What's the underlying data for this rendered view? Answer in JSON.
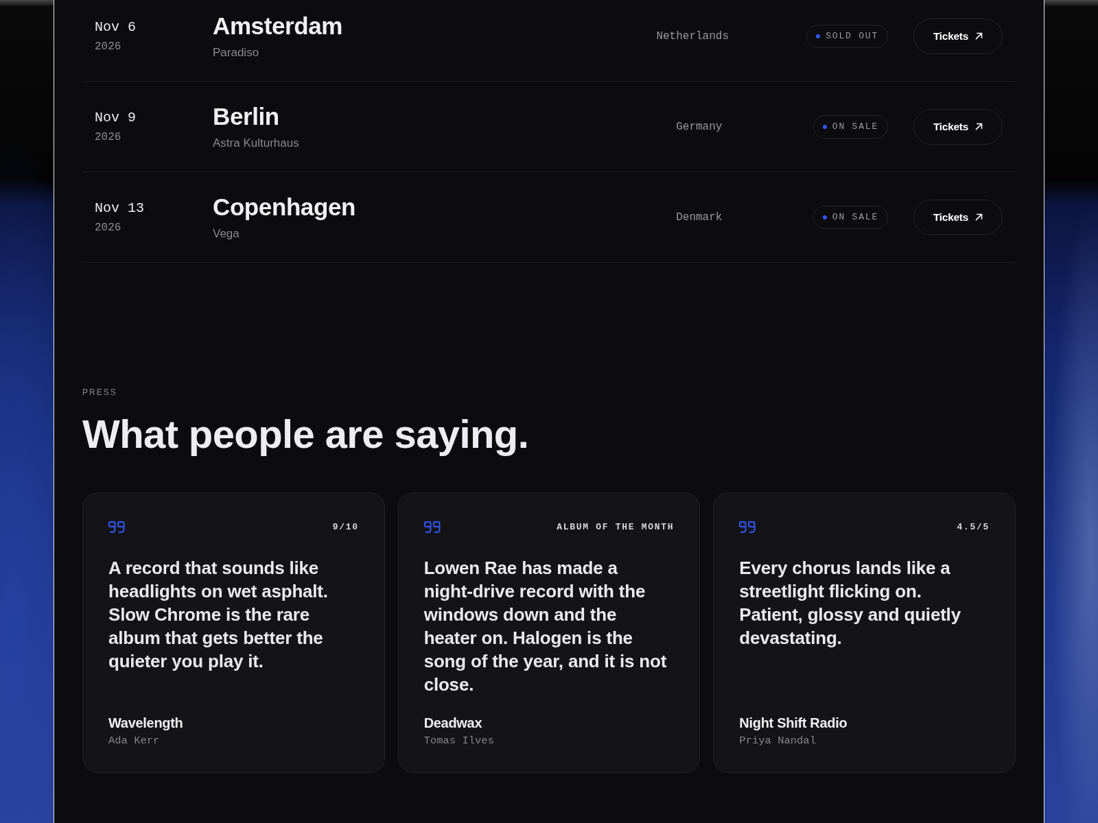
{
  "tour_dates": [
    {
      "date": "Nov 6",
      "year": "2026",
      "city": "Amsterdam",
      "venue": "Paradiso",
      "country": "Netherlands",
      "status": "SOLD OUT",
      "button": "Tickets"
    },
    {
      "date": "Nov 9",
      "year": "2026",
      "city": "Berlin",
      "venue": "Astra Kulturhaus",
      "country": "Germany",
      "status": "ON SALE",
      "button": "Tickets"
    },
    {
      "date": "Nov 13",
      "year": "2026",
      "city": "Copenhagen",
      "venue": "Vega",
      "country": "Denmark",
      "status": "ON SALE",
      "button": "Tickets"
    }
  ],
  "press": {
    "eyebrow": "PRESS",
    "heading": "What people are saying.",
    "reviews": [
      {
        "tag": "9/10",
        "quote": "A record that sounds like headlights on wet asphalt. Slow Chrome is the rare album that gets better the quieter you play it.",
        "outlet": "Wavelength",
        "author": "Ada Kerr"
      },
      {
        "tag": "ALBUM OF THE MONTH",
        "quote": "Lowen Rae has made a night-drive record with the windows down and the heater on. Halogen is the song of the year, and it is not close.",
        "outlet": "Deadwax",
        "author": "Tomas Ilves"
      },
      {
        "tag": "4.5/5",
        "quote": "Every chorus lands like a streetlight flicking on. Patient, glossy and quietly devastating.",
        "outlet": "Night Shift Radio",
        "author": "Priya Nandal"
      }
    ]
  }
}
